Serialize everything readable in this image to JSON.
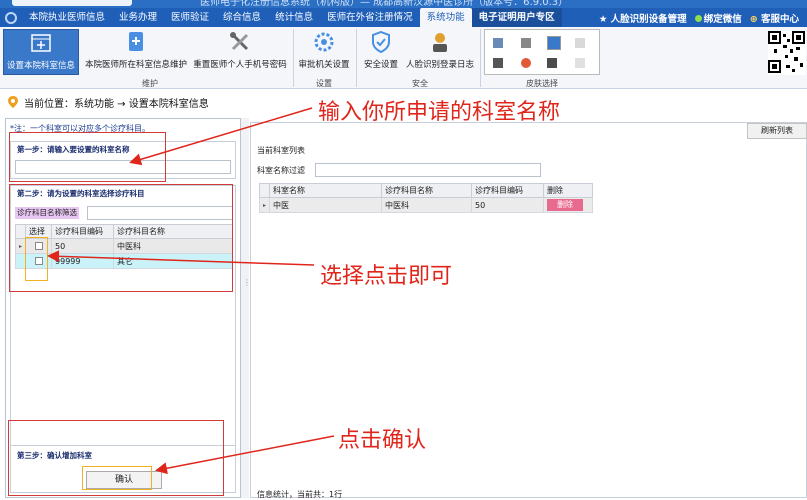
{
  "window": {
    "search_placeholder": "",
    "title_text": "医师电子化注册信息系统（机构版）— 成都高新汉源中医诊所（版本号：6.9.0.3）"
  },
  "menu": {
    "items": [
      "本院执业医师信息",
      "业务办理",
      "医师验证",
      "综合信息",
      "统计信息",
      "医师在外省注册情况",
      "系统功能",
      "电子证明用户专区"
    ],
    "active_index": 6,
    "right": {
      "face": "人脸识别设备管理",
      "wechat": "绑定微信",
      "service": "客服中心"
    }
  },
  "ribbon": {
    "buttons": [
      "设置本院科室信息",
      "本院医师所在科室信息维护",
      "重置医师个人手机号密码",
      "审批机关设置",
      "安全设置",
      "人脸识别登录日志"
    ],
    "groups": {
      "maintain": "维护",
      "settings": "设置",
      "security": "安全",
      "skin": "皮肤选择"
    }
  },
  "location": {
    "label": "当前位置：系统功能 → 设置本院科室信息"
  },
  "left": {
    "note": "*注：一个科室可以对应多个诊疗科目。",
    "step1": "第一步：请输入要设置的科室名称",
    "step2": "第二步：请为设置的科室选择诊疗科目",
    "filter_label": "诊疗科目名称筛选",
    "table": {
      "headers": [
        "选择",
        "诊疗科目编码",
        "诊疗科目名称"
      ],
      "rows": [
        [
          "50",
          "中医科"
        ],
        [
          "99999",
          "其它"
        ]
      ]
    },
    "step3": "第三步：确认增加科室",
    "confirm": "确认"
  },
  "right": {
    "refresh": "刷新列表",
    "list_title": "当前科室列表",
    "filter_label": "科室名称过滤",
    "table": {
      "headers": [
        "科室名称",
        "诊疗科目名称",
        "诊疗科目编码",
        "删除"
      ],
      "rows": [
        {
          "dept": "中医",
          "subject": "中医科",
          "code": "50",
          "action": "删除"
        }
      ]
    },
    "status": "信息统计，当前共：1行"
  },
  "annotations": {
    "a1": "输入你所申请的科室名称",
    "a2": "选择点击即可",
    "a3": "点击确认"
  },
  "colors": {
    "menubar": "#1f5fb8",
    "annotation": "#e0261b",
    "highlight_row": "#c9f3f8",
    "delete": "#e86a8f"
  }
}
